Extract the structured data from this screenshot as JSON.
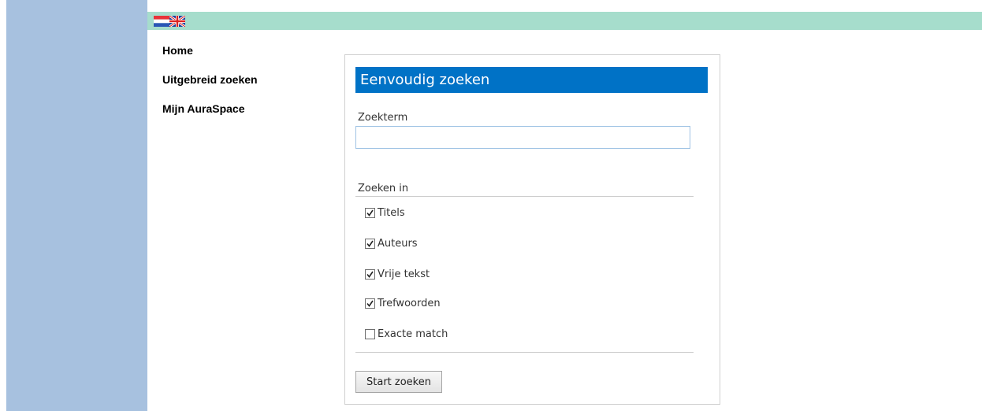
{
  "languages": [
    {
      "name": "Nederlands",
      "icon": "flag-nl-icon"
    },
    {
      "name": "English",
      "icon": "flag-uk-icon"
    }
  ],
  "nav": {
    "items": [
      {
        "label": "Home"
      },
      {
        "label": "Uitgebreid zoeken"
      },
      {
        "label": "Mijn AuraSpace"
      }
    ]
  },
  "search_panel": {
    "title": "Eenvoudig zoeken",
    "term_label": "Zoekterm",
    "term_value": "",
    "search_in_label": "Zoeken in",
    "options": [
      {
        "label": "Titels",
        "checked": true
      },
      {
        "label": "Auteurs",
        "checked": true
      },
      {
        "label": "Vrije tekst",
        "checked": true
      },
      {
        "label": "Trefwoorden",
        "checked": true
      },
      {
        "label": "Exacte match",
        "checked": false
      }
    ],
    "submit_label": "Start zoeken"
  },
  "colors": {
    "left_strip": "#a7c1df",
    "top_bar": "#a6ddcc",
    "header_blue": "#0072c6"
  }
}
